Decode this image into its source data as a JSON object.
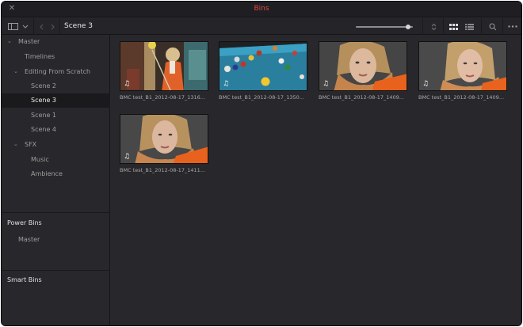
{
  "window": {
    "title": "Bins",
    "title_color": "#e2463e"
  },
  "toolbar": {
    "breadcrumb": "Scene 3",
    "zoom_level": 0.95,
    "icons": [
      "sidebar-toggle-icon",
      "chevron-down-icon",
      "back-arrow-icon",
      "forward-arrow-icon",
      "sort-icon",
      "thumbnail-view-icon",
      "list-view-icon",
      "search-icon",
      "more-icon"
    ]
  },
  "sidebar": {
    "tree": [
      {
        "label": "Master",
        "expanded": true
      },
      {
        "label": "Timelines"
      },
      {
        "label": "Editing From Scratch",
        "expanded": true
      },
      {
        "label": "Scene 2"
      },
      {
        "label": "Scene 3",
        "selected": true
      },
      {
        "label": "Scene 1"
      },
      {
        "label": "Scene 4"
      },
      {
        "label": "SFX",
        "expanded": true
      },
      {
        "label": "Music"
      },
      {
        "label": "Ambience"
      }
    ],
    "power_bins": {
      "heading": "Power Bins",
      "items": [
        {
          "label": "Master"
        }
      ]
    },
    "smart_bins": {
      "heading": "Smart Bins"
    }
  },
  "clips": [
    {
      "name": "BMC test_B1_2012-08-17_1316...",
      "scene": "woman-cue"
    },
    {
      "name": "BMC test_B1_2012-08-17_1350...",
      "scene": "pool-table"
    },
    {
      "name": "BMC test_B1_2012-08-17_1409...",
      "scene": "woman-portrait"
    },
    {
      "name": "BMC test_B1_2012-08-17_1409...",
      "scene": "woman-portrait-2"
    },
    {
      "name": "BMC test_B1_2012-08-17_1411...",
      "scene": "woman-portrait-3"
    }
  ],
  "colors": {
    "accent": "#e2463e",
    "background": "#28282c",
    "selected": "#1a1a1d"
  }
}
